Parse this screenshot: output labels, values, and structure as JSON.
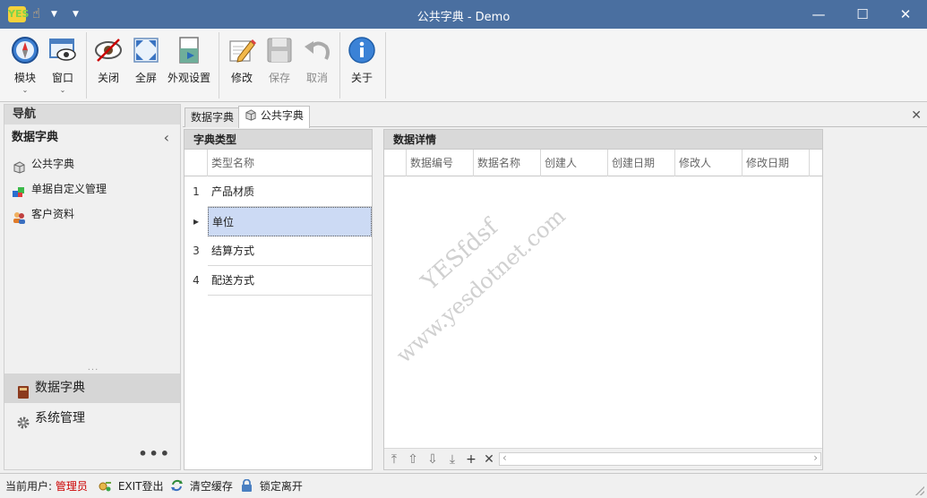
{
  "window": {
    "app_icon_text": "YES",
    "title": "公共字典 - Demo",
    "minimize_glyph": "—",
    "maximize_glyph": "☐",
    "close_glyph": "✕"
  },
  "ribbon": {
    "module": "模块",
    "window": "窗口",
    "close": "关闭",
    "fullscreen": "全屏",
    "appearance": "外观设置",
    "edit": "修改",
    "save": "保存",
    "cancel": "取消",
    "about": "关于",
    "dropdown_glyph": "⌄"
  },
  "nav": {
    "header": "导航",
    "group_title": "数据字典",
    "collapse_glyph": "‹",
    "items": [
      {
        "label": "公共字典",
        "icon": "cube-icon"
      },
      {
        "label": "单据自定义管理",
        "icon": "puzzle-icon"
      },
      {
        "label": "客户资料",
        "icon": "users-icon"
      }
    ],
    "splitter_glyph": "...",
    "sections": [
      {
        "label": "数据字典",
        "icon": "book-icon",
        "active": true
      },
      {
        "label": "系统管理",
        "icon": "gear-icon",
        "active": false
      }
    ],
    "more_glyph": "•••"
  },
  "tabs": [
    {
      "label": "数据字典",
      "active": false
    },
    {
      "label": "公共字典",
      "active": true
    }
  ],
  "tab_close_glyph": "✕",
  "dict_types": {
    "title": "字典类型",
    "column": "类型名称",
    "rows": [
      {
        "indicator": "1",
        "name": "产品材质",
        "selected": false
      },
      {
        "indicator": "▸",
        "name": "单位",
        "selected": true
      },
      {
        "indicator": "3",
        "name": "结算方式",
        "selected": false
      },
      {
        "indicator": "4",
        "name": "配送方式",
        "selected": false
      }
    ]
  },
  "details": {
    "title": "数据详情",
    "columns": [
      "数据编号",
      "数据名称",
      "创建人",
      "创建日期",
      "修改人",
      "修改日期"
    ]
  },
  "pager": {
    "first_glyph": "⤒",
    "prev_glyph": "⇧",
    "next_glyph": "⇩",
    "last_glyph": "⤓",
    "add_glyph": "+",
    "delete_glyph": "✕",
    "scroll_left_glyph": "‹",
    "scroll_right_glyph": "›"
  },
  "watermark": {
    "line1": "YESfdsf",
    "line2": "www.yesdotnet.com"
  },
  "status": {
    "user_label": "当前用户:",
    "user_value": "管理员",
    "user_color": "#cc0000",
    "exit": "EXIT登出",
    "clear_cache": "清空缓存",
    "lock": "锁定离开"
  }
}
